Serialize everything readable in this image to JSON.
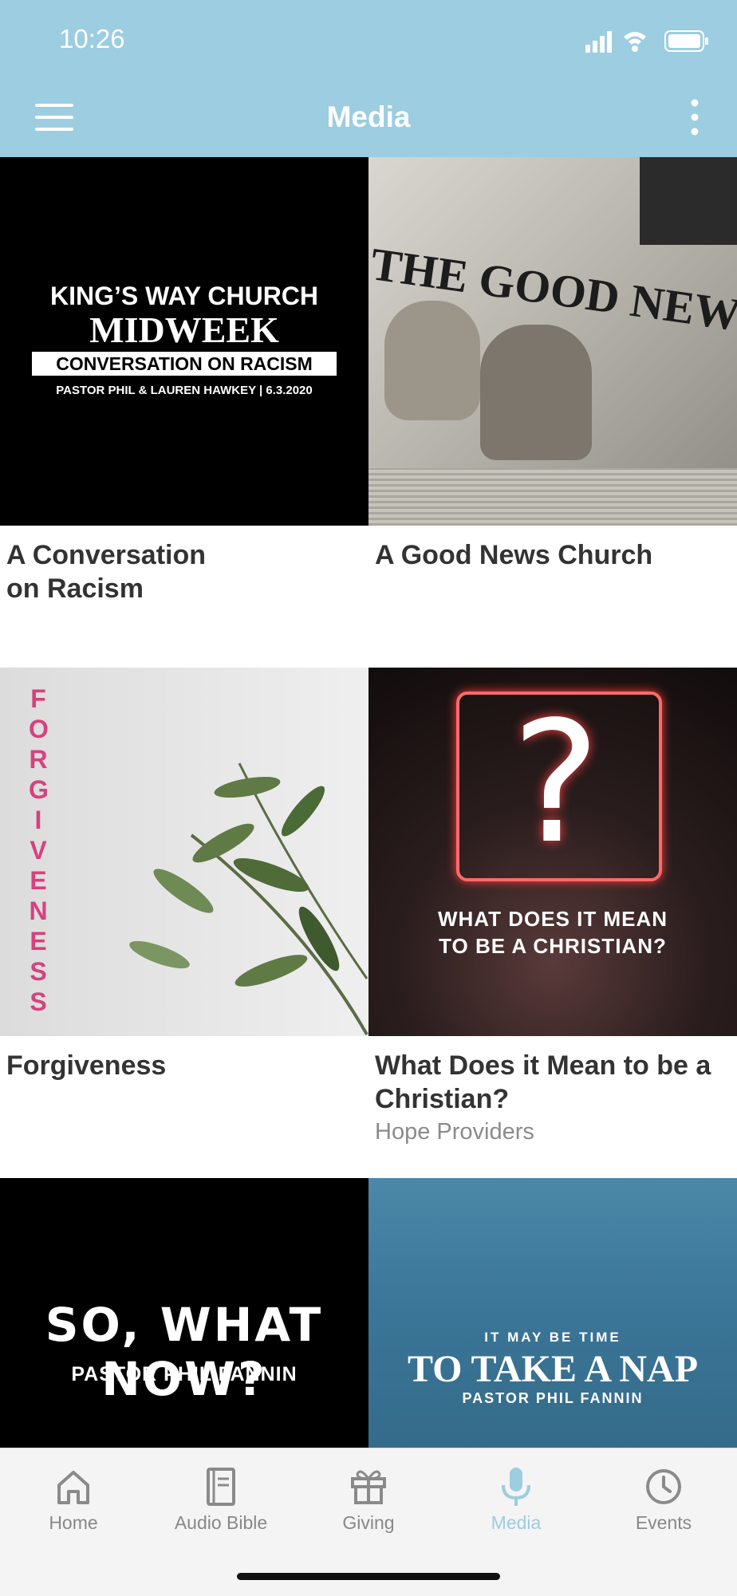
{
  "status": {
    "time": "10:26"
  },
  "header": {
    "title": "Media"
  },
  "items": [
    {
      "title": "A Conversation on Racism",
      "art": {
        "line1": "KING’S WAY CHURCH",
        "line2": "MIDWEEK",
        "line3": "CONVERSATION ON RACISM",
        "line4": "PASTOR PHIL & LAUREN HAWKEY | 6.3.2020"
      }
    },
    {
      "title": "A Good News Church",
      "art": {
        "headline": "THE GOOD NEWS CH"
      }
    },
    {
      "title": "Forgiveness",
      "art": {
        "vertical": "FORGIVENESS"
      }
    },
    {
      "title": "What Does it Mean to be a Christian?",
      "subtitle": "Hope Providers",
      "art": {
        "line1": "WHAT DOES IT MEAN",
        "line2": "TO BE A CHRISTIAN?"
      }
    },
    {
      "art": {
        "line1": "SO, WHAT NOW?",
        "line2": "PASTOR PHIL FANNIN"
      }
    },
    {
      "art": {
        "line1": "IT MAY BE TIME",
        "line2": "TO TAKE A NAP",
        "line3": "PASTOR PHIL FANNIN"
      }
    }
  ],
  "tabs": [
    {
      "label": "Home",
      "icon": "home-icon"
    },
    {
      "label": "Audio Bible",
      "icon": "book-icon"
    },
    {
      "label": "Giving",
      "icon": "gift-icon"
    },
    {
      "label": "Media",
      "icon": "microphone-icon",
      "active": true
    },
    {
      "label": "Events",
      "icon": "clock-icon"
    }
  ],
  "colors": {
    "header": "#9ccde0",
    "accent": "#9ccde0",
    "forgiveness_pink": "#d6417f"
  }
}
